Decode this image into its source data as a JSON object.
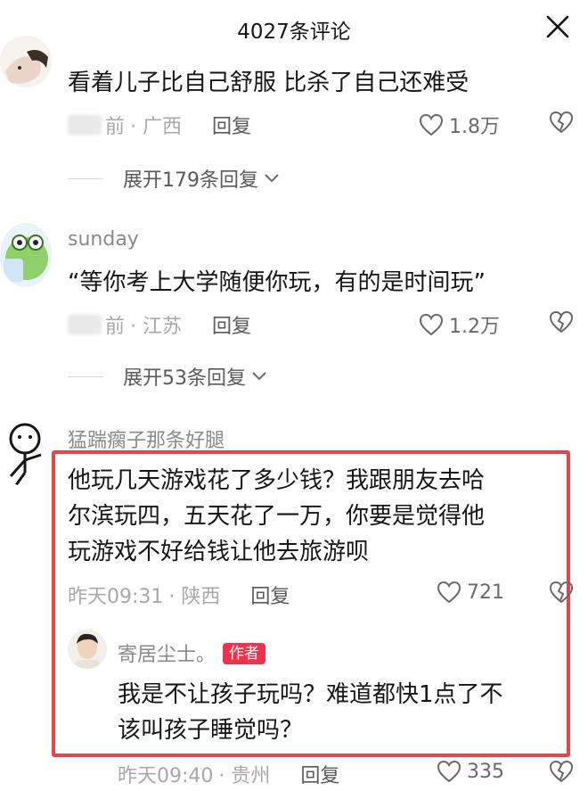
{
  "header": {
    "title": "4027条评论"
  },
  "comments": [
    {
      "text": "看着儿子比自己舒服 比杀了自己还难受",
      "time": "前",
      "location": "· 广西",
      "reply_label": "回复",
      "likes": "1.8万",
      "expand_label": "展开179条回复"
    },
    {
      "username": "sunday",
      "text": "“等你考上大学随便你玩，有的是时间玩”",
      "time": "前",
      "location": "· 江苏",
      "reply_label": "回复",
      "likes": "1.2万",
      "expand_label": "展开53条回复"
    },
    {
      "username": "猛踹瘸子那条好腿",
      "text_lines": [
        "他玩几天游戏花了多少钱？我跟朋友去哈",
        "尔滨玩四，五天花了一万，你要是觉得他",
        "玩游戏不好给钱让他去旅游呗"
      ],
      "time": "昨天09:31",
      "location": "· 陕西",
      "reply_label": "回复",
      "likes": "721",
      "reply": {
        "username": "寄居尘士。",
        "badge": "作者",
        "text_lines": [
          "我是不让孩子玩吗？难道都快1点了不",
          "该叫孩子睡觉吗？"
        ],
        "time": "昨天09:40",
        "location": "· 贵州",
        "reply_label": "回复",
        "likes": "335"
      }
    }
  ],
  "colors": {
    "highlight": "#e8454b",
    "author_badge": "#f0324c",
    "meta_gray": "#a8a8a8"
  },
  "icons": [
    "close-icon",
    "heart-icon",
    "broken-heart-icon",
    "chevron-down-icon"
  ]
}
